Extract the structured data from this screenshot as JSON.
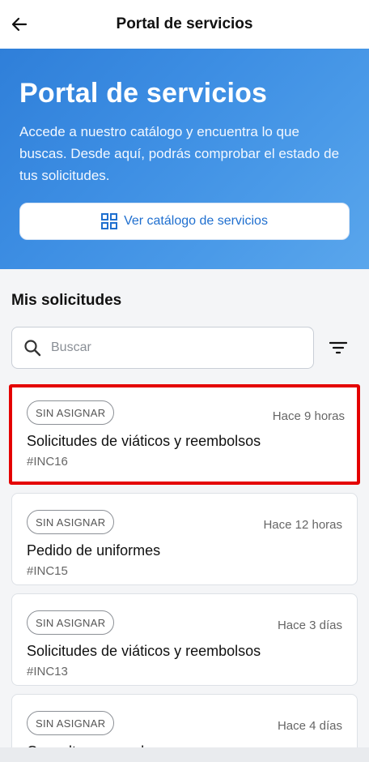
{
  "header": {
    "title": "Portal de servicios",
    "back_icon": "arrow-left-icon"
  },
  "hero": {
    "title": "Portal de servicios",
    "description": "Accede a nuestro catálogo y encuentra lo que buscas. Desde aquí, podrás comprobar el estado de tus solicitudes.",
    "catalog_button": "Ver catálogo de servicios",
    "catalog_icon": "grid-icon"
  },
  "requests": {
    "section_title": "Mis solicitudes",
    "search_placeholder": "Buscar",
    "items": [
      {
        "badge": "SIN ASIGNAR",
        "time": "Hace 9 horas",
        "title": "Solicitudes de viáticos y reembolsos",
        "id": "#INC16"
      },
      {
        "badge": "SIN ASIGNAR",
        "time": "Hace 12 horas",
        "title": "Pedido de uniformes",
        "id": "#INC15"
      },
      {
        "badge": "SIN ASIGNAR",
        "time": "Hace 3 días",
        "title": "Solicitudes de viáticos y reembolsos",
        "id": "#INC13"
      },
      {
        "badge": "SIN ASIGNAR",
        "time": "Hace 4 días",
        "title": "Consultas generales",
        "id": ""
      }
    ]
  },
  "colors": {
    "hero_start": "#2f7fd9",
    "hero_end": "#5aa6ec",
    "accent": "#1f6fcf",
    "highlight": "#e40000"
  }
}
